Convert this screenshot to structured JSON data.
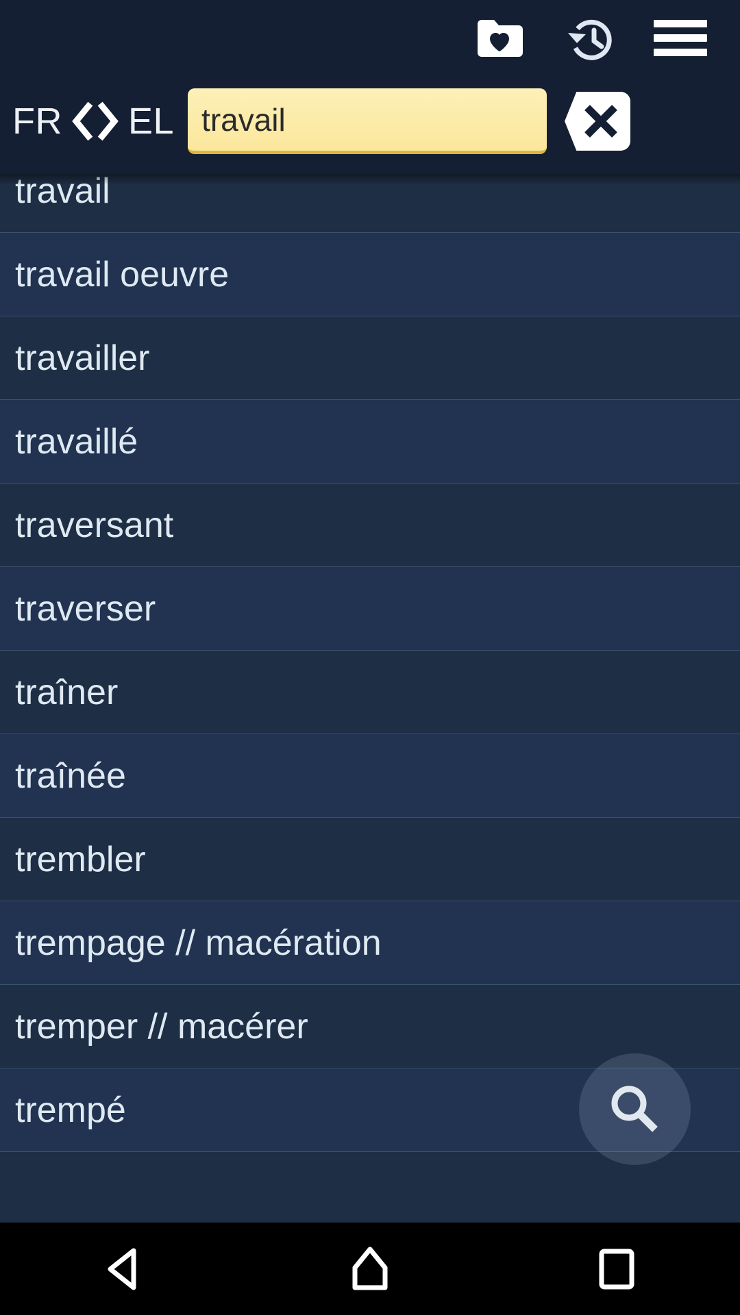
{
  "header": {
    "actions": [
      {
        "name": "favorites-folder-icon",
        "label": "Favorites"
      },
      {
        "name": "history-icon",
        "label": "History"
      },
      {
        "name": "menu-icon",
        "label": "Menu"
      }
    ],
    "language": {
      "source": "FR",
      "target": "EL",
      "swap_icon": "swap-arrows-icon"
    },
    "search": {
      "value": "travail",
      "placeholder": "Search",
      "clear_label": "✕"
    }
  },
  "list": {
    "items": [
      {
        "label": "travail"
      },
      {
        "label": "travail oeuvre"
      },
      {
        "label": "travailler"
      },
      {
        "label": "travaillé"
      },
      {
        "label": "traversant"
      },
      {
        "label": "traverser"
      },
      {
        "label": "traîner"
      },
      {
        "label": "traînée"
      },
      {
        "label": "trembler"
      },
      {
        "label": "trempage // macération"
      },
      {
        "label": "tremper // macérer"
      },
      {
        "label": "trempé"
      },
      {
        "label": ""
      }
    ]
  },
  "fab": {
    "name": "search-fab",
    "label": "Search"
  },
  "navbar": {
    "buttons": [
      {
        "name": "back-button",
        "label": "Back"
      },
      {
        "name": "home-button",
        "label": "Home"
      },
      {
        "name": "recents-button",
        "label": "Recents"
      }
    ]
  },
  "colors": {
    "header_bg": "#141f33",
    "list_bg": "#1e2e45",
    "list_bg_alt": "#213350",
    "divider": "#3b526d",
    "text": "#dfe9f2",
    "input_bg": "#fbe79c",
    "input_underline": "#e0b63a",
    "input_text": "#2b2b2b",
    "navbar_bg": "#000000"
  }
}
